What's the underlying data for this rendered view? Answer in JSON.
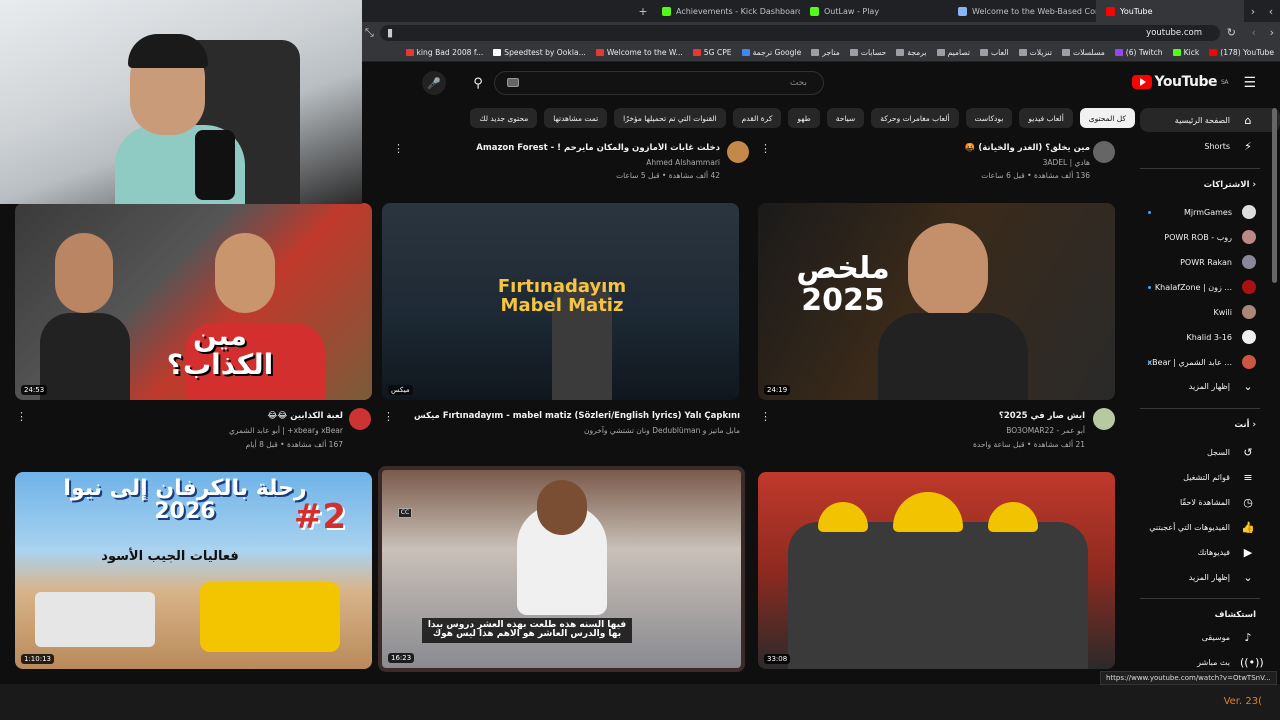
{
  "browser": {
    "tabs": [
      {
        "title": "YouTube",
        "active": true,
        "icon_color": "#ff0000"
      },
      {
        "title": "Welcome to the Web-Based Configurator",
        "active": false,
        "icon_color": "#8ab4f8"
      },
      {
        "title": "OutLaw - Play",
        "active": false,
        "icon_color": "#53fc18"
      },
      {
        "title": "Achievements - Kick Dashboard",
        "active": false,
        "icon_color": "#53fc18"
      }
    ],
    "address": "youtube.com",
    "bookmarks": [
      "(178) YouTube",
      "Kick",
      "(6) Twitch",
      "مسلسلات",
      "تنزيلات",
      "العاب",
      "تصاميم",
      "برمجة",
      "حسابات",
      "متاجر",
      "ترجمة Google",
      "5G CPE",
      "Welcome to the W...",
      "Speedtest by Ookla...",
      "king Bad 2008 f..."
    ]
  },
  "youtube": {
    "logo": "YouTube",
    "region": "SA",
    "search_placeholder": "بحث",
    "chips": [
      "كل المحتوى",
      "ألعاب فيديو",
      "بودكاست",
      "ألعاب مغامرات وحركة",
      "سياحة",
      "طهو",
      "كرة القدم",
      "القنوات التي تم تحميلها مؤخرًا",
      "تمت مشاهدتها",
      "محتوى جديد لك"
    ]
  },
  "sidebar": {
    "home": "الصفحة الرئيسية",
    "shorts": "Shorts",
    "subscriptions_header": "الاشتراكات",
    "subscriptions": [
      "MjrmGames",
      "POWR ROB - روب",
      "POWR Rakan",
      "KhalafZone | زون ...",
      "Kwili",
      "Khalid 3-16",
      "xBear | عابد الشمري ..."
    ],
    "show_more": "إظهار المزيد",
    "you_header": "أنت",
    "you_items": [
      "السجل",
      "قوائم التشغيل",
      "المشاهدة لاحقًا",
      "الفيديوهات التي أعجبتني",
      "فيديوهاتك",
      "إظهار المزيد"
    ],
    "explore_header": "استكشاف",
    "explore_items": [
      "موسيقى",
      "بث مباشر"
    ]
  },
  "videos_top": [
    {
      "title": "دخلت غابات الأمازون والمكان مايرحم ! - Amazon Forest",
      "channel": "Ahmed Alshammari",
      "meta": "42 ألف مشاهدة • قبل 5 ساعات"
    },
    {
      "title": "مين يخلق؟ (الغدر والخيانة) 🤬",
      "channel": "هادي | 3ADEL",
      "meta": "136 ألف مشاهدة • قبل 6 ساعات"
    }
  ],
  "videos_row1": [
    {
      "title": "لعبة الكذابين 😂😂",
      "channel": "xBear وxbear+ | أبو عابد الشمري",
      "meta": "167 ألف مشاهدة • قبل 8 أيام",
      "duration": "24:53",
      "overlay": "مين الكذاب؟"
    },
    {
      "title": "Fırtınadayım - mabel matiz (Sözleri/English lyrics) Yalı Çapkını ميكس",
      "channel": "مابل ماتيز و Dedublüman ونان تشتشي وآخرون",
      "meta": "",
      "duration": "ميكس",
      "overlay": "Fırtınadayım\nMabel Matiz"
    },
    {
      "title": "ايش صار في 2025؟",
      "channel": "أبو عمر - BO3OMAR22",
      "meta": "21 ألف مشاهدة • قبل ساعة واحدة",
      "duration": "24:19",
      "overlay": "ملخص 2025"
    }
  ],
  "videos_row2": [
    {
      "duration": "1:10:13",
      "overlay": "رحلة بالكرفان إلى نيوا 2026",
      "sub": "فعاليات الجيب الأسود",
      "badge": "#2"
    },
    {
      "duration": "16:23",
      "subtitle": "فيها السنه هذه طلعت بهذه العشر دروس ببدا\nبها والدرس العاشر هو الاهم هذا ليس هوك"
    },
    {
      "duration": "33:08"
    }
  ],
  "status_url": "https://www.youtube.com/watch?v=OtwTSnV...",
  "version": "Ver. 23("
}
